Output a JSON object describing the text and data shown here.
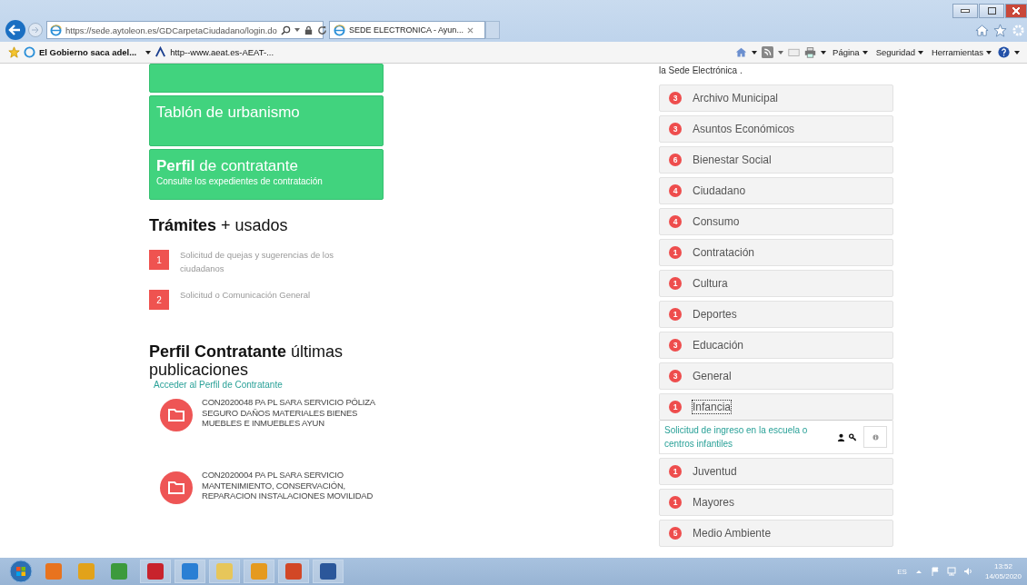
{
  "browser": {
    "address": "https://sede.aytoleon.es/GDCarpetaCiudadano/login.do",
    "tab_title": "SEDE ELECTRONICA - Ayun...",
    "favorites": [
      {
        "text": "El Gobierno saca adel...",
        "bold": true,
        "dropdown": true
      },
      {
        "text": "http--www.aeat.es-AEAT-...",
        "bold": false,
        "dropdown": false
      }
    ],
    "commands": [
      "Página",
      "Seguridad",
      "Herramientas"
    ]
  },
  "tiles": [
    {
      "title": "Tablón de urbanismo"
    },
    {
      "title": "**Perfil** de contratante",
      "subtitle": "Consulte los expedientes de contratación"
    }
  ],
  "tramites": {
    "title": "**Trámites** + usados",
    "items": [
      {
        "number": "1",
        "text": "Solicitud de quejas y sugerencias de los ciudadanos"
      },
      {
        "number": "2",
        "text": "Solicitud o Comunicación General"
      }
    ]
  },
  "perfil": {
    "title": "**Perfil Contratante** últimas publicaciones",
    "link": "Acceder al Perfil de Contratante",
    "items": [
      {
        "text": "CON2020048 PA PL SARA SERVICIO PÓLIZA SEGURO DAÑOS MATERIALES BIENES MUEBLES E INMUEBLES AYUN"
      },
      {
        "text": "CON2020004 PA PL SARA SERVICIO MANTENIMIENTO, CONSERVACIÓN, REPARACION INSTALACIONES MOVILIDAD"
      }
    ]
  },
  "intro": "la Sede Electrónica .",
  "categories": [
    {
      "count": "3",
      "name": "Archivo Municipal",
      "expanded": false
    },
    {
      "count": "3",
      "name": "Asuntos Económicos",
      "expanded": false
    },
    {
      "count": "6",
      "name": "Bienestar Social",
      "expanded": false
    },
    {
      "count": "4",
      "name": "Ciudadano",
      "expanded": false
    },
    {
      "count": "4",
      "name": "Consumo",
      "expanded": false
    },
    {
      "count": "1",
      "name": "Contratación",
      "expanded": false
    },
    {
      "count": "1",
      "name": "Cultura",
      "expanded": false
    },
    {
      "count": "1",
      "name": "Deportes",
      "expanded": false
    },
    {
      "count": "3",
      "name": "Educación",
      "expanded": false
    },
    {
      "count": "3",
      "name": "General",
      "expanded": false
    },
    {
      "count": "1",
      "name": "Infancia",
      "expanded": true,
      "children": [
        {
          "text": "Solicitud de ingreso en la escuela o centros infantiles"
        }
      ]
    },
    {
      "count": "1",
      "name": "Juventud",
      "expanded": false
    },
    {
      "count": "1",
      "name": "Mayores",
      "expanded": false
    },
    {
      "count": "5",
      "name": "Medio Ambiente",
      "expanded": false
    }
  ],
  "taskbar": {
    "language": "ES",
    "time": "13:52",
    "date": "14/05/2020"
  }
}
